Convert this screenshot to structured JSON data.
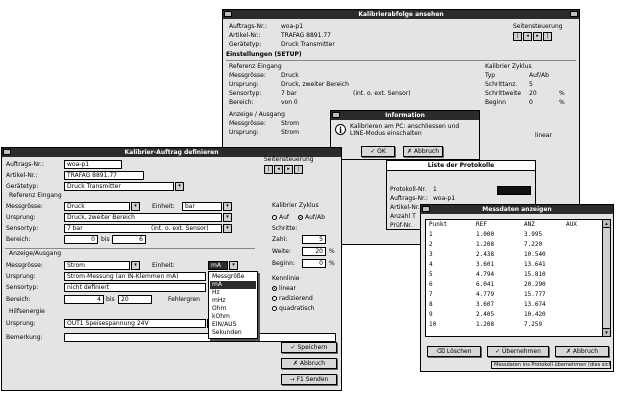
{
  "cal_window": {
    "title": "Kalibrierabfolge ansehen",
    "auftrag_label": "Auftrags-Nr.:",
    "auftrag_value": "woa-p1",
    "artikel_label": "Artikel-Nr.:",
    "artikel_value": "TRAFAG 8891.77",
    "geraet_label": "Gerätetyp:",
    "geraet_value": "Druck Transmitter",
    "seiten_label": "Seitensteuerung",
    "section_setup": "Einstellungen (SETUP)",
    "eingang_label": "Referenz Eingang",
    "messgroesse_label": "Messgrösse:",
    "messgroesse_value": "Druck",
    "ursprung_label": "Ursprung:",
    "ursprung_value": "Druck, zweiter Bereich",
    "sensor_label": "Sensortyp:",
    "sensor_value": "7 bar",
    "sensor_note": "(int. o. ext. Sensor)",
    "bereich_label": "Bereich:",
    "bereich_value": "von 0",
    "anzeige_label": "Anzeige / Ausgang",
    "messg2_label": "Messgrösse:",
    "messg2_value": "Strom",
    "urspr2_label": "Ursprung:",
    "urspr2_value": "Strom",
    "kal_zyklus_label": "Kalibrier Zyklus",
    "typ_label": "Typ",
    "typ_value": "Auf/Ab",
    "schritt_label": "Schrittanz.",
    "schritt_value": "5",
    "schrittw_label": "Schrittweite",
    "schrittw_value": "20",
    "pct1": "%",
    "beginn_label": "Beginn",
    "beginn_value": "0",
    "pct2": "%",
    "linear_label": "linear"
  },
  "info_dialog": {
    "title": "Information",
    "message": "Kalibrieren am PC: anschliessen und LINE-Modus einschalten",
    "ok": "OK",
    "abbruch": "Abbruch"
  },
  "protocol_window": {
    "title": "Liste der Protokolle",
    "prot_label": "Protokoll-Nr.",
    "prot_value": "1",
    "auftrag_label": "Auftrags-Nr.:",
    "auftrag_value": "woa-p1",
    "artikel_label": "Artikel-Nr.",
    "anzahl_label": "Anzahl T",
    "pruef_label": "Prüf-Nr."
  },
  "define_window": {
    "title": "Kalibrier-Auftrag definieren",
    "auftrag_label": "Auftrags-Nr.:",
    "auftrag_value": "woa-p1",
    "artikel_label": "Artikel-Nr.:",
    "artikel_value": "TRAFAG 8891.77",
    "geraet_label": "Gerätetyp:",
    "geraet_value": "Druck Transmitter",
    "seiten_label": "Seitensteuerung",
    "eingang_label": "Referenz Eingang",
    "messgroesse_label": "Messgrösse:",
    "messgroesse_value": "Druck",
    "einheit_label": "Einheit:",
    "einheit_value": "bar",
    "ursprung_label": "Ursprung:",
    "ursprung_value": "Druck, zweiter Bereich",
    "sensor_label": "Sensortyp:",
    "sensor_value": "7 bar",
    "sensor_note": "(int. o. ext. Sensor)",
    "bereich_label": "Bereich:",
    "bereich_from": "0",
    "bis": "bis",
    "bereich_to": "6",
    "ausgang_label": "Anzeige/Ausgang",
    "messg2_label": "Messgrösse:",
    "messg2_value": "Strom",
    "einheit2_label": "Einheit:",
    "einheit2_value": "mA",
    "urspr2_label": "Ursprung:",
    "urspr2_value": "Strom-Messung (an IN-Klemmen mA)",
    "sensor2_label": "Sensortyp:",
    "sensor2_value": "nicht definiert",
    "bereich2_label": "Bereich:",
    "bereich2_from": "4",
    "bis2": "bis",
    "bereich2_to": "20",
    "fehler_label": "Fehlergren",
    "hilf_label": "Hilfsenergie",
    "ursprung3_label": "Ursprung:",
    "ursprung3_value": "OUT1 Speisespannung 24V",
    "bemerkung_label": "Bemerkung:",
    "zyklus_label": "Kalibrier Zyklus",
    "auf_label": "Auf",
    "aufab_label": "Auf/Ab",
    "schritte_label": "Schritte:",
    "zahl_label": "Zahl:",
    "zahl_value": "5",
    "weite_label": "Weite:",
    "weite_value": "20",
    "pct1": "%",
    "beginn_label": "Beginn:",
    "beginn_value": "0",
    "pct2": "%",
    "kennlinie_label": "Kennlinie",
    "linear_label": "linear",
    "radiz_label": "radizierend",
    "quadr_label": "quadratisch",
    "speichern": "Speichern",
    "abbruch": "Abbruch",
    "senden": "F1 Senden",
    "einheit_options": [
      "Messgröße",
      "mA",
      "Hz",
      "mHz",
      "Ohm",
      "kOhm",
      "EIN/AUS",
      "Sekunden"
    ],
    "einheit_selected": "mA"
  },
  "messdaten_window": {
    "title": "Messdaten anzeigen",
    "columns": [
      "Punkt",
      "REF",
      "ANZ",
      "AUX"
    ],
    "rows": [
      [
        "1",
        "1.000",
        "3.995",
        ""
      ],
      [
        "2",
        "1.208",
        "7.220",
        ""
      ],
      [
        "3",
        "2.438",
        "10.540",
        ""
      ],
      [
        "4",
        "3.601",
        "13.641",
        ""
      ],
      [
        "5",
        "4.794",
        "15.810",
        ""
      ],
      [
        "6",
        "6.041",
        "20.290",
        ""
      ],
      [
        "7",
        "4.779",
        "15.777",
        ""
      ],
      [
        "8",
        "3.607",
        "13.674",
        ""
      ],
      [
        "9",
        "2.405",
        "10.420",
        ""
      ],
      [
        "10",
        "1.208",
        "7.259",
        ""
      ]
    ],
    "loeschen": "Löschen",
    "uebernehmen": "Übernehmen",
    "abbruch": "Abbruch",
    "footer": "Messdaten ins Protokoll übernehmen (dies sichern)"
  }
}
